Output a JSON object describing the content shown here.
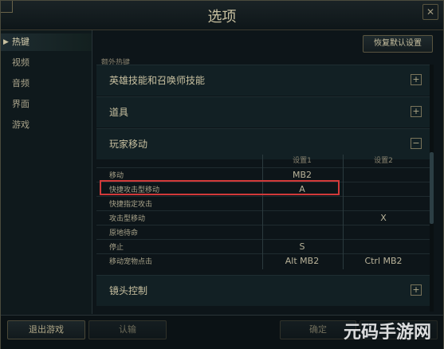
{
  "window": {
    "title": "选项",
    "close_glyph": "✕"
  },
  "sidebar": {
    "items": [
      {
        "label": "热键",
        "active": true
      },
      {
        "label": "视频",
        "active": false
      },
      {
        "label": "音频",
        "active": false
      },
      {
        "label": "界面",
        "active": false
      },
      {
        "label": "游戏",
        "active": false
      }
    ]
  },
  "header": {
    "restore_button": "恢复默认设置",
    "extra_hotkeys_label": "额外热键"
  },
  "sections": [
    {
      "title": "英雄技能和召唤师技能",
      "toggle": "+"
    },
    {
      "title": "道具",
      "toggle": "+"
    },
    {
      "title": "玩家移动",
      "toggle": "−"
    },
    {
      "title": "镜头控制",
      "toggle": "+"
    }
  ],
  "movement_table": {
    "columns": [
      "设置1",
      "设置2"
    ],
    "rows": [
      {
        "label": "移动",
        "set1": "MB2",
        "set2": ""
      },
      {
        "label": "快捷攻击型移动",
        "set1": "A",
        "set2": ""
      },
      {
        "label": "快捷指定攻击",
        "set1": "",
        "set2": ""
      },
      {
        "label": "攻击型移动",
        "set1": "",
        "set2": "X"
      },
      {
        "label": "原地待命",
        "set1": "",
        "set2": ""
      },
      {
        "label": "停止",
        "set1": "S",
        "set2": ""
      },
      {
        "label": "移动宠物点击",
        "set1": "Alt  MB2",
        "set2": "Ctrl  MB2"
      }
    ]
  },
  "footer": {
    "exit_game": "退出游戏",
    "surrender": "认输",
    "confirm": "确定",
    "cancel": ""
  },
  "watermark": "元码手游网",
  "colors": {
    "highlight": "#d23a3a",
    "accent": "#c8c0a0"
  }
}
